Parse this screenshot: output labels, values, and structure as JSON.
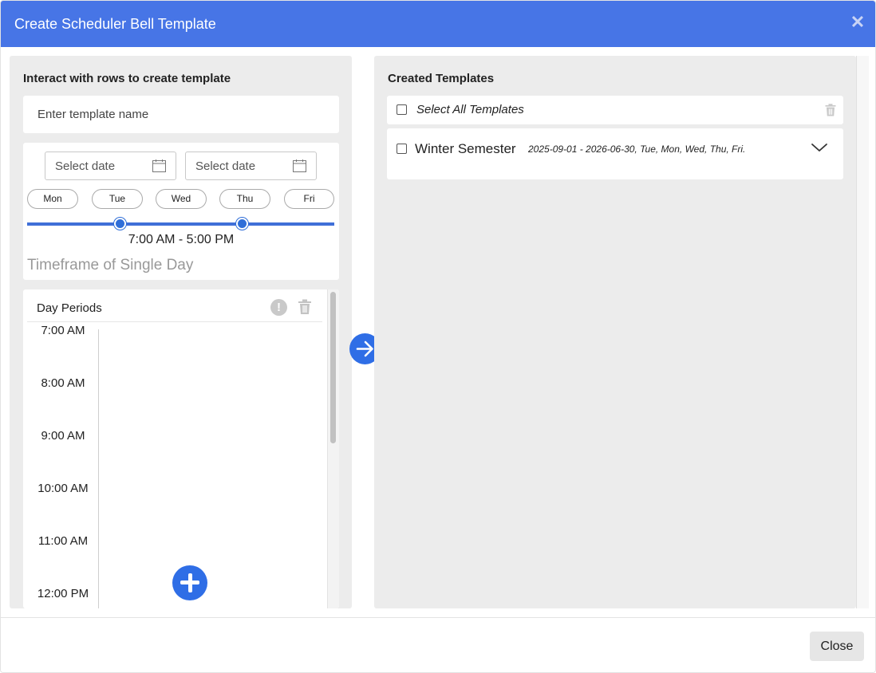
{
  "modal": {
    "title": "Create Scheduler Bell Template",
    "close_icon": "close-icon"
  },
  "left": {
    "heading": "Interact with rows to create template",
    "template_name_placeholder": "Enter template name",
    "start_date_placeholder": "Select date",
    "end_date_placeholder": "Select date",
    "calendar_icon": "calendar-icon",
    "days": [
      "Mon",
      "Tue",
      "Wed",
      "Thu",
      "Fri"
    ],
    "time_range": "7:00 AM - 5:00 PM",
    "timeframe_label": "Timeframe of Single Day",
    "day_periods": {
      "title": "Day Periods",
      "info_icon": "info-icon",
      "trash_icon": "trash-icon",
      "add_icon": "plus-icon",
      "times": [
        "7:00 AM",
        "8:00 AM",
        "9:00 AM",
        "10:00 AM",
        "11:00 AM",
        "12:00 PM"
      ]
    }
  },
  "transfer_icon": "arrow-right-icon",
  "right": {
    "heading": "Created Templates",
    "select_all_label": "Select All Templates",
    "templates": [
      {
        "name": "Winter Semester",
        "meta": "2025-09-01 - 2026-06-30, Tue, Mon, Wed, Thu, Fri."
      }
    ]
  },
  "footer": {
    "close_label": "Close"
  }
}
